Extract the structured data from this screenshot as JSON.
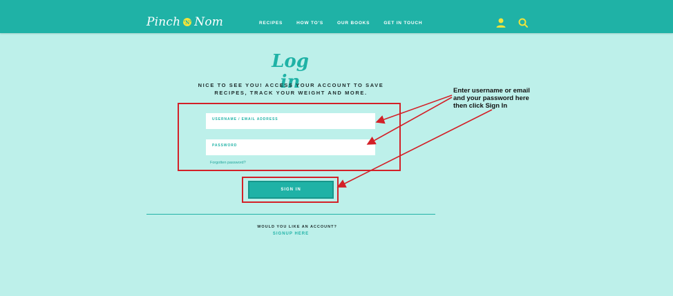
{
  "header": {
    "logo_left": "Pinch",
    "logo_badge": "'N'",
    "logo_right": "Nom",
    "nav": [
      "RECIPES",
      "HOW TO'S",
      "OUR BOOKS",
      "GET IN TOUCH"
    ],
    "icons": [
      "user-icon",
      "search-icon"
    ],
    "accent_color": "#f3e43a",
    "brand_color": "#1fb2a6"
  },
  "login": {
    "title": "Log in",
    "intro": "NICE TO SEE YOU! ACCESS YOUR ACCOUNT TO SAVE RECIPES, TRACK YOUR WEIGHT AND MORE.",
    "username_label": "USERNAME / EMAIL ADDRESS",
    "username_value": "",
    "password_label": "PASSWORD",
    "password_value": "",
    "forgot_label": "Forgotten password?",
    "signin_label": "SIGN IN",
    "account_question": "WOULD YOU LIKE AN ACCOUNT?",
    "signup_label": "SIGNUP HERE"
  },
  "annotation": {
    "text": "Enter username or email and your password here then click Sign In",
    "color": "#d32027"
  }
}
